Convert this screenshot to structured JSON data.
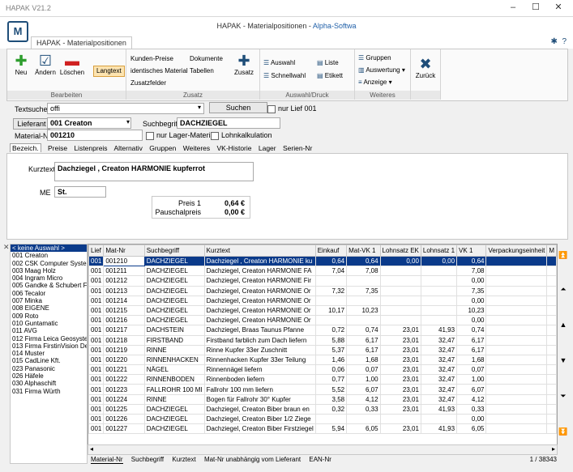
{
  "window": {
    "title": "HAPAK V21.2",
    "minimize": "–",
    "maximize": "☐",
    "close": "✕"
  },
  "header": {
    "title_part1": "HAPAK - Materialpositionen - ",
    "title_part2": "Alpha-Softwa",
    "tab": "HAPAK - Materialpositionen",
    "logo": "M"
  },
  "ribbon": {
    "bearbeiten": {
      "label": "Bearbeiten",
      "neu": "Neu",
      "aendern": "Ändern",
      "loeschen": "Löschen",
      "langtext": "Langtext"
    },
    "zusatz": {
      "label": "Zusatz",
      "kunden_preise": "Kunden-Preise",
      "identisches": "identisches Material",
      "zusatzfelder": "Zusatzfelder",
      "dokumente": "Dokumente",
      "tabellen": "Tabellen",
      "zusatz_btn": "Zusatz"
    },
    "auswahl": {
      "label": "Auswahl/Druck",
      "auswahl": "Auswahl",
      "schnellwahl": "Schnellwahl",
      "liste": "Liste",
      "etikett": "Etikett"
    },
    "weiteres": {
      "label": "Weiteres",
      "gruppen": "Gruppen",
      "auswertung": "Auswertung",
      "anzeige": "Anzeige"
    },
    "zurueck": "Zurück"
  },
  "search": {
    "textsuche_label": "Textsuche",
    "textsuche_value": "offi",
    "suchen": "Suchen",
    "nur_lief": "nur Lief 001",
    "lieferant_btn": "Lieferant",
    "lieferant_value": "001 Creaton",
    "suchbegriff_label": "Suchbegriff",
    "suchbegriff_value": "DACHZIEGEL",
    "matnr_label": "Material-Nr",
    "matnr_value": "001210",
    "nur_lager": "nur Lager-Material",
    "lohnkalk": "Lohnkalkulation"
  },
  "detail_tabs": [
    "Bezeich.",
    "Preise",
    "Listenpreis",
    "Alternativ",
    "Gruppen",
    "Weiteres",
    "VK-Historie",
    "Lager",
    "Serien-Nr"
  ],
  "detail": {
    "kurztext_label": "Kurztext",
    "kurztext_value": "Dachziegel , Creaton  HARMONIE kupferrot",
    "me_label": "ME",
    "me_value": "St.",
    "preis1_label": "Preis 1",
    "preis1_value": "0,64 €",
    "pauschal_label": "Pauschalpreis",
    "pauschal_value": "0,00 €"
  },
  "suppliers": [
    "< keine Auswahl >",
    "001 Creaton",
    "002 CSK Computer Syster",
    "003 Maag Holz",
    "004 Ingram Micro",
    "005 Gandke & Schubert F",
    "006 Tecalor",
    "007 Minka",
    "008 EIGENE",
    "009 Roto",
    "010 Guntamatic",
    "011 AVG",
    "012 Firma Leica Geosyste",
    "013 Firma FirstinVision Der",
    "014 Muster",
    "015 CadLine Kft.",
    "023 Panasonic",
    "026 Häfele",
    "030 Alphaschift",
    "031 Firma Würth"
  ],
  "table": {
    "headers": [
      "Lief",
      "Mat-Nr",
      "Suchbegriff",
      "Kurztext",
      "Einkauf",
      "Mat-VK 1",
      "Lohnsatz EK",
      "Lohnsatz 1",
      "VK 1",
      "Verpackungseinheit",
      "M"
    ],
    "rows": [
      [
        "001",
        "001210",
        "DACHZIEGEL",
        "Dachziegel , Creaton  HARMONIE ku",
        "0,64",
        "0,64",
        "0,00",
        "0,00",
        "0,64",
        "",
        ""
      ],
      [
        "001",
        "001211",
        "DACHZIEGEL",
        "Dachziegel, Creaton  HARMONIE FA",
        "7,04",
        "7,08",
        "",
        "",
        "7,08",
        "",
        ""
      ],
      [
        "001",
        "001212",
        "DACHZIEGEL",
        "Dachziegel, Creaton  HARMONIE Fir",
        "",
        "",
        "",
        "",
        "0,00",
        "",
        ""
      ],
      [
        "001",
        "001213",
        "DACHZIEGEL",
        "Dachziegel, Creaton  HARMONIE Or",
        "7,32",
        "7,35",
        "",
        "",
        "7,35",
        "",
        ""
      ],
      [
        "001",
        "001214",
        "DACHZIEGEL",
        "Dachziegel, Creaton  HARMONIE Or",
        "",
        "",
        "",
        "",
        "0,00",
        "",
        ""
      ],
      [
        "001",
        "001215",
        "DACHZIEGEL",
        "Dachziegel, Creaton  HARMONIE Or",
        "10,17",
        "10,23",
        "",
        "",
        "10,23",
        "",
        ""
      ],
      [
        "001",
        "001216",
        "DACHZIEGEL",
        "Dachziegel, Creaton  HARMONIE Or",
        "",
        "",
        "",
        "",
        "0,00",
        "",
        ""
      ],
      [
        "001",
        "001217",
        "DACHSTEIN",
        "Dachziegel, Braas Taunus Pfanne",
        "0,72",
        "0,74",
        "23,01",
        "41,93",
        "0,74",
        "",
        ""
      ],
      [
        "001",
        "001218",
        "FIRSTBAND",
        "Firstband  farblich zum Dach liefern",
        "5,88",
        "6,17",
        "23,01",
        "32,47",
        "6,17",
        "",
        ""
      ],
      [
        "001",
        "001219",
        "RINNE",
        "Rinne Kupfer 33er Zuschnitt",
        "5,37",
        "6,17",
        "23,01",
        "32,47",
        "6,17",
        "",
        ""
      ],
      [
        "001",
        "001220",
        "RINNENHACKEN",
        "Rinnenhacken Kupfer 33er Teilung",
        "1,46",
        "1,68",
        "23,01",
        "32,47",
        "1,68",
        "",
        ""
      ],
      [
        "001",
        "001221",
        "NÄGEL",
        "Rinnennägel liefern",
        "0,06",
        "0,07",
        "23,01",
        "32,47",
        "0,07",
        "",
        ""
      ],
      [
        "001",
        "001222",
        "RINNENBODEN",
        "Rinnenboden liefern",
        "0,77",
        "1,00",
        "23,01",
        "32,47",
        "1,00",
        "",
        ""
      ],
      [
        "001",
        "001223",
        "FALLROHR 100 MI",
        "Fallrohr 100 mm liefern",
        "5,52",
        "6,07",
        "23,01",
        "32,47",
        "6,07",
        "",
        ""
      ],
      [
        "001",
        "001224",
        "RINNE",
        "Bogen für Fallrohr 30° Kupfer",
        "3,58",
        "4,12",
        "23,01",
        "32,47",
        "4,12",
        "",
        ""
      ],
      [
        "001",
        "001225",
        "DACHZIEGEL",
        "Dachziegel, Creaton  Biber  braun en",
        "0,32",
        "0,33",
        "23,01",
        "41,93",
        "0,33",
        "",
        ""
      ],
      [
        "001",
        "001226",
        "DACHZIEGEL",
        "Dachziegel, Creaton  Biber 1/2 Ziege",
        "",
        "",
        "",
        "",
        "0,00",
        "",
        ""
      ],
      [
        "001",
        "001227",
        "DACHZIEGEL",
        "Dachziegel, Creaton  Biber Firstziegel",
        "5,94",
        "6,05",
        "23,01",
        "41,93",
        "6,05",
        "",
        ""
      ]
    ]
  },
  "sort_tabs": [
    "Material-Nr",
    "Suchbegriff",
    "Kurztext",
    "Mat-Nr unabhängig vom Lieferant",
    "EAN-Nr"
  ],
  "record_count": "1 / 38343"
}
